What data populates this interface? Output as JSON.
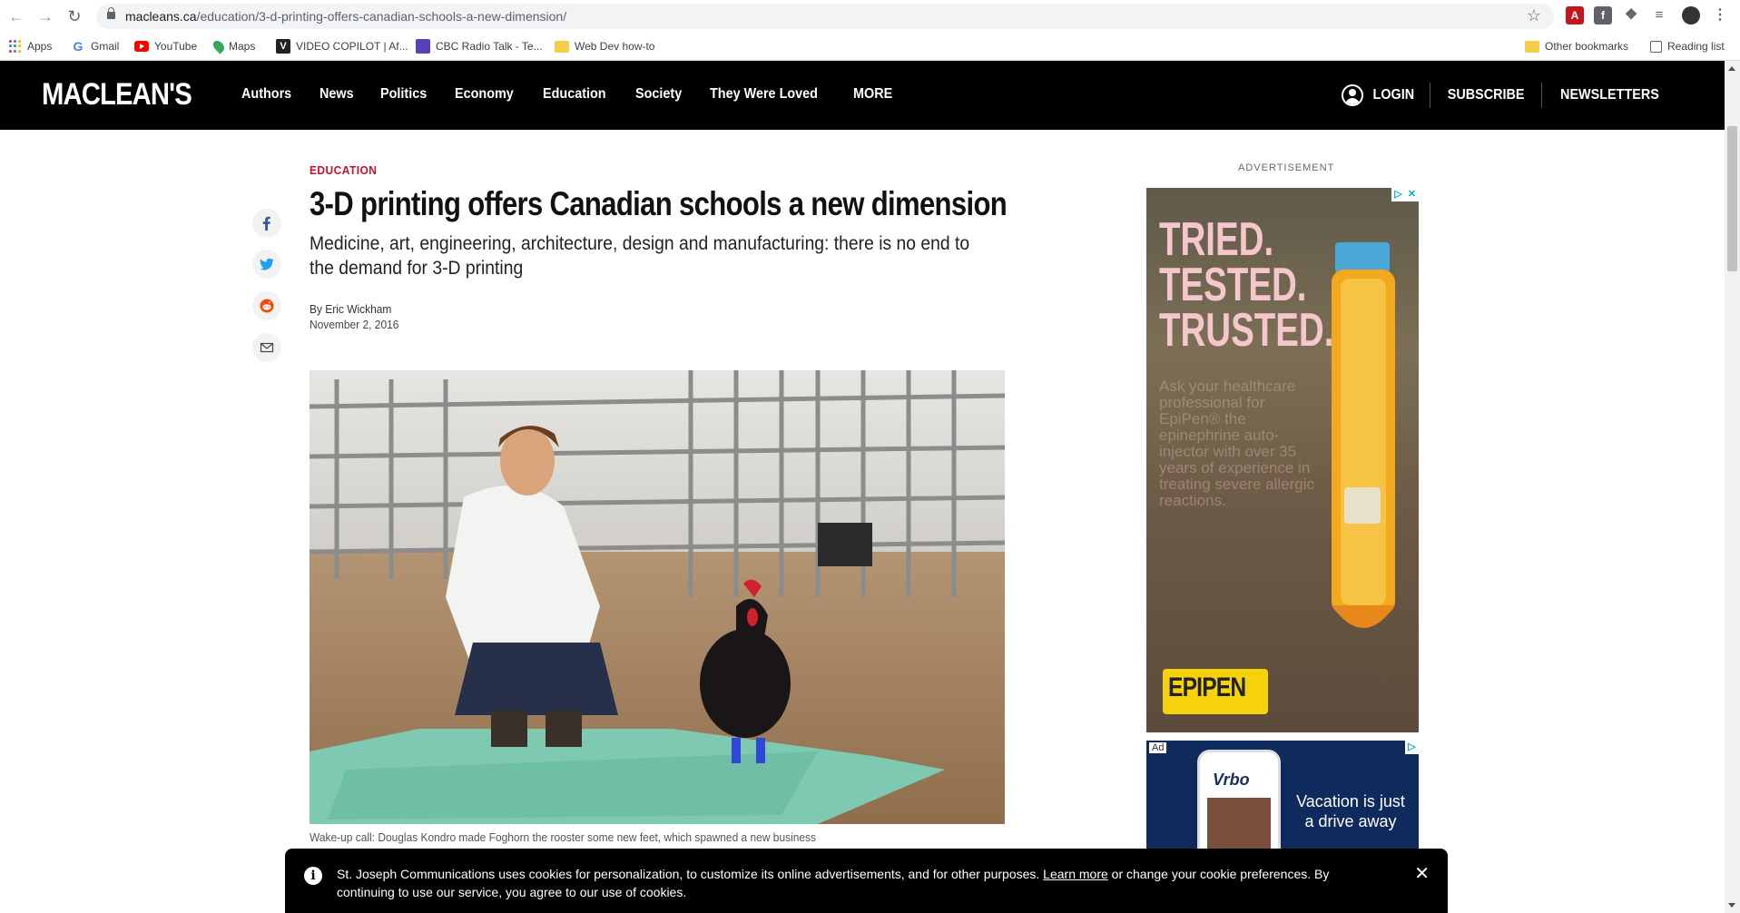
{
  "browser": {
    "url_host": "macleans.ca",
    "url_path": "/education/3-d-printing-offers-canadian-schools-a-new-dimension/",
    "bookmarks": [
      {
        "label": "Apps",
        "icon": "apps-grid-icon"
      },
      {
        "label": "Gmail",
        "icon": "google-icon"
      },
      {
        "label": "YouTube",
        "icon": "youtube-icon"
      },
      {
        "label": "Maps",
        "icon": "maps-icon"
      },
      {
        "label": "VIDEO COPILOT | Af...",
        "icon": "videocopilot-icon"
      },
      {
        "label": "CBC Radio Talk - Te...",
        "icon": "cbc-icon"
      },
      {
        "label": "Web Dev how-to",
        "icon": "folder-icon"
      }
    ],
    "other_bookmarks": "Other bookmarks",
    "reading_list": "Reading list"
  },
  "site": {
    "logo": "MACLEAN'S",
    "nav": [
      "Authors",
      "News",
      "Politics",
      "Economy",
      "Education",
      "Society",
      "They Were Loved",
      "MORE"
    ],
    "login": "LOGIN",
    "subscribe": "SUBSCRIBE",
    "newsletters": "NEWSLETTERS"
  },
  "article": {
    "kicker": "EDUCATION",
    "headline": "3-D printing offers Canadian schools a new dimension",
    "dek": "Medicine, art, engineering, architecture, design and manufacturing: there is no end to the demand for 3-D printing",
    "byline": "By Eric Wickham",
    "date": "November 2, 2016",
    "caption": "Wake-up call: Douglas Kondro made Foghorn the rooster some new feet, which spawned a new business"
  },
  "share": [
    "facebook-icon",
    "twitter-icon",
    "reddit-icon",
    "email-icon"
  ],
  "ads": {
    "label": "ADVERTISEMENT",
    "ad1_headline": [
      "TRIED.",
      "TESTED.",
      "TRUSTED."
    ],
    "ad1_body": "Ask your healthcare professional for EpiPen® the epinephrine auto-injector with over 35 years of experience in treating severe allergic reactions.",
    "ad1_brand": "EPIPEN",
    "ad2_tag": "Ad",
    "ad2_brand": "Vrbo",
    "ad2_tagline": "Vacation is just a drive away"
  },
  "cookie": {
    "text_before": "St. Joseph Communications uses cookies for personalization, to customize its online advertisements, and for other purposes. ",
    "link": "Learn more",
    "text_after": " or change your cookie preferences. By continuing to use our service, you agree to our use of cookies.",
    "close": "✕"
  },
  "colors": {
    "accent_red": "#c8102e",
    "header_bg": "#000000",
    "ad_yellow": "#f5d20c"
  }
}
